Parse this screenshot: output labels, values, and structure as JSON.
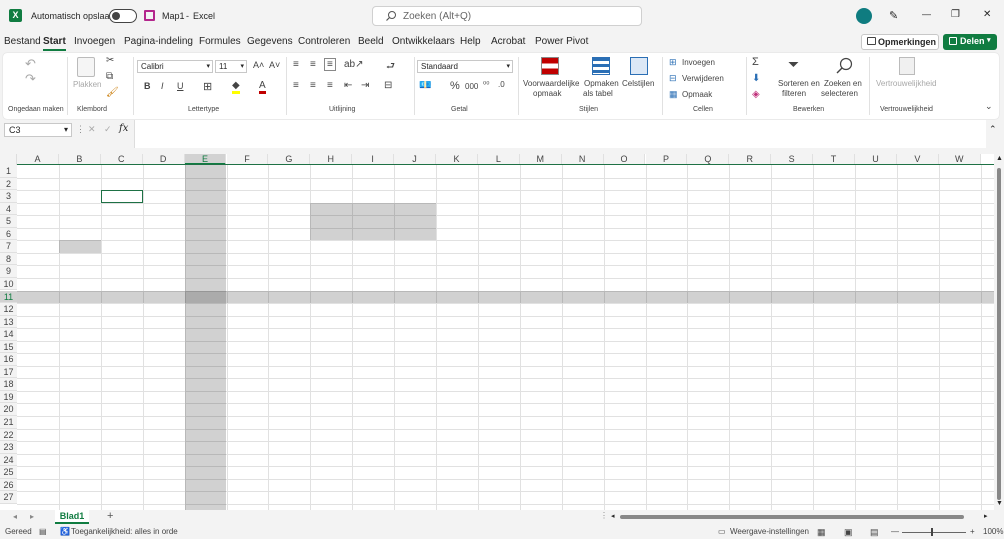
{
  "titlebar": {
    "autosave_label": "Automatisch opslaan",
    "doc_name": "Map1",
    "app_name": "Excel",
    "search_placeholder": "Zoeken (Alt+Q)",
    "min_glyph": "—",
    "max_glyph": "❐",
    "close_glyph": "✕",
    "pen_glyph": "✎",
    "save_glyph": "💾",
    "logo_glyph": "X"
  },
  "menu": {
    "tabs": [
      "Bestand",
      "Start",
      "Invoegen",
      "Pagina-indeling",
      "Formules",
      "Gegevens",
      "Controleren",
      "Beeld",
      "Ontwikkelaars",
      "Help",
      "Acrobat",
      "Power Pivot"
    ],
    "comments": "Opmerkingen",
    "share": "Delen"
  },
  "ribbon": {
    "undo_group": "Ongedaan maken",
    "clipboard": {
      "paste": "Plakken",
      "group": "Klembord"
    },
    "font": {
      "name": "Calibri",
      "size": "11",
      "bold": "B",
      "italic": "I",
      "underline": "U",
      "grow": "A˄",
      "shrink": "A˅",
      "group": "Lettertype"
    },
    "alignment": {
      "group": "Uitlijning"
    },
    "number": {
      "format": "Standaard",
      "percent": "%",
      "thousands": "000",
      "group": "Getal"
    },
    "styles": {
      "conditional_l1": "Voorwaardelijke",
      "conditional_l2": "opmaak",
      "table_l1": "Opmaken",
      "table_l2": "als tabel",
      "cellstyles": "Celstijlen",
      "group": "Stijlen"
    },
    "cells": {
      "insert": "Invoegen",
      "delete": "Verwijderen",
      "format": "Opmaak",
      "group": "Cellen"
    },
    "editing": {
      "sort_l1": "Sorteren en",
      "sort_l2": "filteren",
      "find_l1": "Zoeken en",
      "find_l2": "selecteren",
      "group": "Bewerken",
      "sigma": "Σ"
    },
    "sensitivity": {
      "label": "Vertrouwelijkheid",
      "group": "Vertrouwelijkheid"
    }
  },
  "formula_bar": {
    "name_box": "C3",
    "fx": "fx",
    "cancel": "✕",
    "enter": "✓"
  },
  "grid": {
    "columns": [
      "A",
      "B",
      "C",
      "D",
      "E",
      "F",
      "G",
      "H",
      "I",
      "J",
      "K",
      "L",
      "M",
      "N",
      "O",
      "P",
      "Q",
      "R",
      "S",
      "T",
      "U",
      "V",
      "W"
    ],
    "rows": [
      "1",
      "2",
      "3",
      "4",
      "5",
      "6",
      "7",
      "8",
      "9",
      "10",
      "11",
      "12",
      "13",
      "14",
      "15",
      "16",
      "17",
      "18",
      "19",
      "20",
      "21",
      "22",
      "23",
      "24",
      "25",
      "26",
      "27"
    ],
    "active_cell": "C3"
  },
  "sheets": {
    "tabs": [
      "Blad1"
    ],
    "add": "+"
  },
  "status": {
    "ready": "Gereed",
    "accessibility": "Toegankelijkheid: alles in orde",
    "display_settings": "Weergave-instellingen",
    "zoom": "100%",
    "minus": "—",
    "plus": "+"
  },
  "colors": {
    "accent": "#107c41",
    "avatar": "#0f7c80",
    "selection": "#d2d2d2"
  }
}
